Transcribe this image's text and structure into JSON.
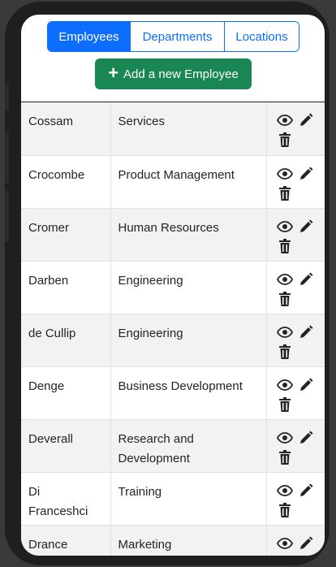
{
  "tabs": [
    {
      "label": "Employees",
      "active": true
    },
    {
      "label": "Departments",
      "active": false
    },
    {
      "label": "Locations",
      "active": false
    }
  ],
  "add_button": {
    "label": "Add a new Employee",
    "icon": "plus-icon"
  },
  "employees": [
    {
      "name": "Cossam",
      "department": "Services"
    },
    {
      "name": "Crocombe",
      "department": "Product Management"
    },
    {
      "name": "Cromer",
      "department": "Human Resources"
    },
    {
      "name": "Darben",
      "department": "Engineering"
    },
    {
      "name": "de Cullip",
      "department": "Engineering"
    },
    {
      "name": "Denge",
      "department": "Business Development"
    },
    {
      "name": "Deverall",
      "department": "Research and Development"
    },
    {
      "name": "Di Franceshci",
      "department": "Training"
    },
    {
      "name": "Drance",
      "department": "Marketing"
    }
  ],
  "row_actions": [
    "eye-icon",
    "pencil-icon",
    "trash-icon"
  ],
  "colors": {
    "primary": "#0d6efd",
    "success": "#198754",
    "stripe": "#f2f2f2"
  }
}
